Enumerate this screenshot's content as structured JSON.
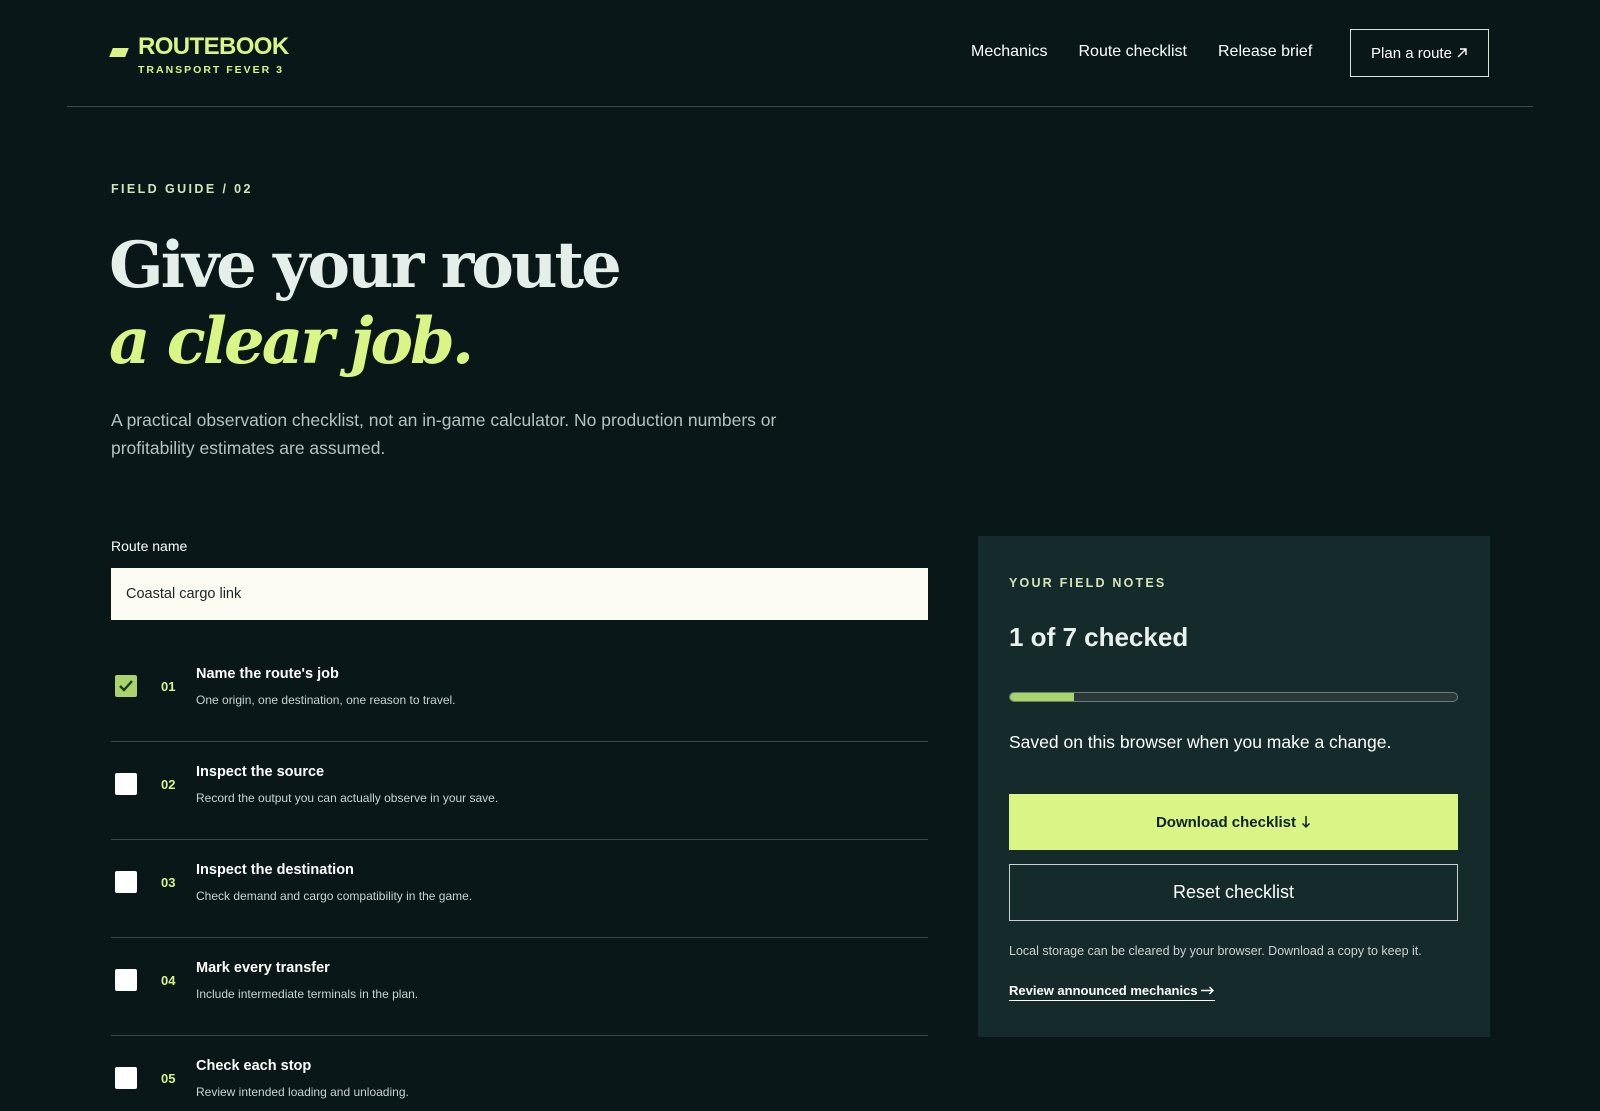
{
  "brand": {
    "name": "ROUTEBOOK",
    "subtitle": "TRANSPORT FEVER 3",
    "accent_color": "#d8f585",
    "background_color": "#0a1719",
    "panel_color": "#152a2b"
  },
  "nav": {
    "items": [
      "Mechanics",
      "Route checklist",
      "Release brief"
    ],
    "cta_label": "Plan a route",
    "cta_icon": "arrow-up-right-icon"
  },
  "hero": {
    "eyebrow": "FIELD GUIDE / 02",
    "headline_line1": "Give your route",
    "headline_line2": "a clear job.",
    "lede": "A practical observation checklist, not an in-game calculator. No production numbers or profitability estimates are assumed."
  },
  "route": {
    "label": "Route name",
    "value": "Coastal cargo link"
  },
  "checklist": {
    "items": [
      {
        "num": "01",
        "title": "Name the route's job",
        "desc": "One origin, one destination, one reason to travel.",
        "checked": true
      },
      {
        "num": "02",
        "title": "Inspect the source",
        "desc": "Record the output you can actually observe in your save.",
        "checked": false
      },
      {
        "num": "03",
        "title": "Inspect the destination",
        "desc": "Check demand and cargo compatibility in the game.",
        "checked": false
      },
      {
        "num": "04",
        "title": "Mark every transfer",
        "desc": "Include intermediate terminals in the plan.",
        "checked": false
      },
      {
        "num": "05",
        "title": "Check each stop",
        "desc": "Review intended loading and unloading.",
        "checked": false
      }
    ]
  },
  "panel": {
    "eyebrow": "YOUR FIELD NOTES",
    "count_text": "1 of 7 checked",
    "progress_fraction": 0.1429,
    "saved_text": "Saved on this browser when you make a change.",
    "download_label": "Download checklist",
    "download_icon": "arrow-down-icon",
    "reset_label": "Reset checklist",
    "note": "Local storage can be cleared by your browser. Download a copy to keep it.",
    "link_label": "Review announced mechanics",
    "link_icon": "arrow-right-icon"
  }
}
